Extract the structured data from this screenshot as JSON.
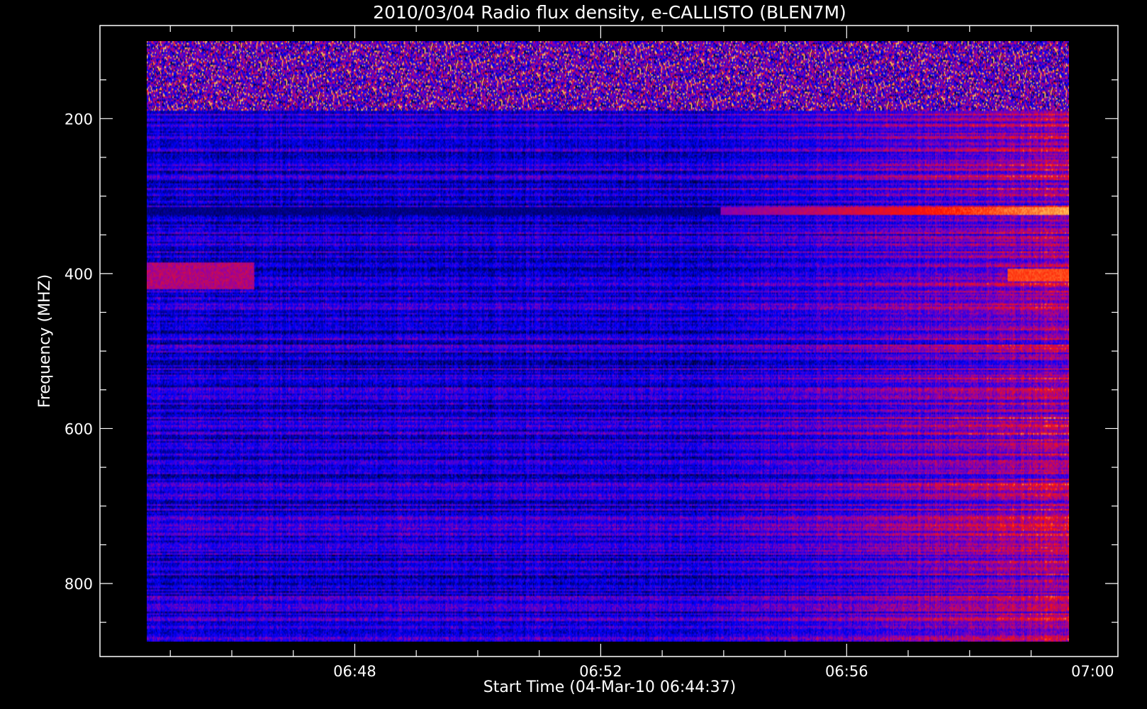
{
  "chart_data": {
    "type": "heatmap",
    "title": "2010/03/04  Radio flux density, e-CALLISTO (BLEN7M)",
    "xlabel": "Start Time (04-Mar-10 06:44:37)",
    "ylabel": "Frequency (MHZ)",
    "x_ticks": [
      "06:48",
      "06:52",
      "06:56",
      "07:00"
    ],
    "y_ticks": [
      "200",
      "400",
      "600",
      "800"
    ],
    "x_range_seconds": [
      0,
      900
    ],
    "y_range_mhz": [
      100,
      875
    ],
    "colors": {
      "background": "#000000",
      "axis": "#ffffff",
      "low": "#1a1aff",
      "high": "#ff2000",
      "peak": "#ffd060"
    },
    "features": [
      {
        "kind": "interference",
        "freq_mhz": [
          100,
          190
        ],
        "time_s": [
          0,
          900
        ],
        "level": "high"
      },
      {
        "kind": "band",
        "freq_mhz": [
          314,
          324
        ],
        "time_s": [
          0,
          900
        ],
        "level": "rising, peak near 07:00"
      },
      {
        "kind": "band",
        "freq_mhz": [
          385,
          420
        ],
        "time_s": [
          0,
          105
        ],
        "level": "moderate"
      },
      {
        "kind": "band",
        "freq_mhz": [
          393,
          410
        ],
        "time_s": [
          840,
          900
        ],
        "level": "high"
      },
      {
        "kind": "emission",
        "freq_mhz": [
          150,
          875
        ],
        "time_s": [
          540,
          900
        ],
        "level": "increasing"
      }
    ]
  }
}
